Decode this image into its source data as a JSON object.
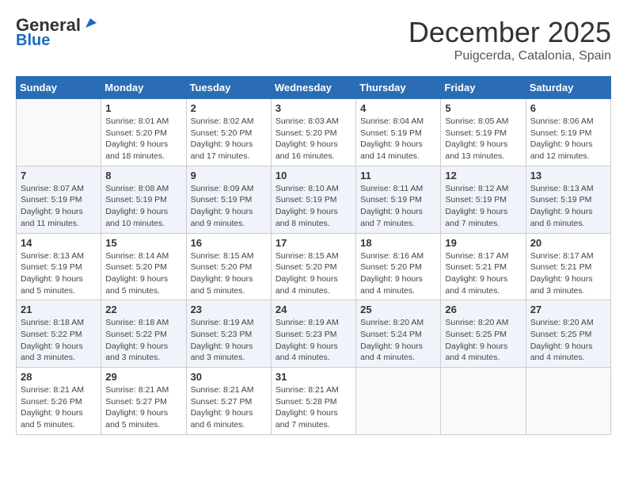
{
  "logo": {
    "line1": "General",
    "line2": "Blue"
  },
  "title": "December 2025",
  "subtitle": "Puigcerda, Catalonia, Spain",
  "weekdays": [
    "Sunday",
    "Monday",
    "Tuesday",
    "Wednesday",
    "Thursday",
    "Friday",
    "Saturday"
  ],
  "weeks": [
    [
      {
        "day": "",
        "info": ""
      },
      {
        "day": "1",
        "info": "Sunrise: 8:01 AM\nSunset: 5:20 PM\nDaylight: 9 hours\nand 18 minutes."
      },
      {
        "day": "2",
        "info": "Sunrise: 8:02 AM\nSunset: 5:20 PM\nDaylight: 9 hours\nand 17 minutes."
      },
      {
        "day": "3",
        "info": "Sunrise: 8:03 AM\nSunset: 5:20 PM\nDaylight: 9 hours\nand 16 minutes."
      },
      {
        "day": "4",
        "info": "Sunrise: 8:04 AM\nSunset: 5:19 PM\nDaylight: 9 hours\nand 14 minutes."
      },
      {
        "day": "5",
        "info": "Sunrise: 8:05 AM\nSunset: 5:19 PM\nDaylight: 9 hours\nand 13 minutes."
      },
      {
        "day": "6",
        "info": "Sunrise: 8:06 AM\nSunset: 5:19 PM\nDaylight: 9 hours\nand 12 minutes."
      }
    ],
    [
      {
        "day": "7",
        "info": "Sunrise: 8:07 AM\nSunset: 5:19 PM\nDaylight: 9 hours\nand 11 minutes."
      },
      {
        "day": "8",
        "info": "Sunrise: 8:08 AM\nSunset: 5:19 PM\nDaylight: 9 hours\nand 10 minutes."
      },
      {
        "day": "9",
        "info": "Sunrise: 8:09 AM\nSunset: 5:19 PM\nDaylight: 9 hours\nand 9 minutes."
      },
      {
        "day": "10",
        "info": "Sunrise: 8:10 AM\nSunset: 5:19 PM\nDaylight: 9 hours\nand 8 minutes."
      },
      {
        "day": "11",
        "info": "Sunrise: 8:11 AM\nSunset: 5:19 PM\nDaylight: 9 hours\nand 7 minutes."
      },
      {
        "day": "12",
        "info": "Sunrise: 8:12 AM\nSunset: 5:19 PM\nDaylight: 9 hours\nand 7 minutes."
      },
      {
        "day": "13",
        "info": "Sunrise: 8:13 AM\nSunset: 5:19 PM\nDaylight: 9 hours\nand 6 minutes."
      }
    ],
    [
      {
        "day": "14",
        "info": "Sunrise: 8:13 AM\nSunset: 5:19 PM\nDaylight: 9 hours\nand 5 minutes."
      },
      {
        "day": "15",
        "info": "Sunrise: 8:14 AM\nSunset: 5:20 PM\nDaylight: 9 hours\nand 5 minutes."
      },
      {
        "day": "16",
        "info": "Sunrise: 8:15 AM\nSunset: 5:20 PM\nDaylight: 9 hours\nand 5 minutes."
      },
      {
        "day": "17",
        "info": "Sunrise: 8:15 AM\nSunset: 5:20 PM\nDaylight: 9 hours\nand 4 minutes."
      },
      {
        "day": "18",
        "info": "Sunrise: 8:16 AM\nSunset: 5:20 PM\nDaylight: 9 hours\nand 4 minutes."
      },
      {
        "day": "19",
        "info": "Sunrise: 8:17 AM\nSunset: 5:21 PM\nDaylight: 9 hours\nand 4 minutes."
      },
      {
        "day": "20",
        "info": "Sunrise: 8:17 AM\nSunset: 5:21 PM\nDaylight: 9 hours\nand 3 minutes."
      }
    ],
    [
      {
        "day": "21",
        "info": "Sunrise: 8:18 AM\nSunset: 5:22 PM\nDaylight: 9 hours\nand 3 minutes."
      },
      {
        "day": "22",
        "info": "Sunrise: 8:18 AM\nSunset: 5:22 PM\nDaylight: 9 hours\nand 3 minutes."
      },
      {
        "day": "23",
        "info": "Sunrise: 8:19 AM\nSunset: 5:23 PM\nDaylight: 9 hours\nand 3 minutes."
      },
      {
        "day": "24",
        "info": "Sunrise: 8:19 AM\nSunset: 5:23 PM\nDaylight: 9 hours\nand 4 minutes."
      },
      {
        "day": "25",
        "info": "Sunrise: 8:20 AM\nSunset: 5:24 PM\nDaylight: 9 hours\nand 4 minutes."
      },
      {
        "day": "26",
        "info": "Sunrise: 8:20 AM\nSunset: 5:25 PM\nDaylight: 9 hours\nand 4 minutes."
      },
      {
        "day": "27",
        "info": "Sunrise: 8:20 AM\nSunset: 5:25 PM\nDaylight: 9 hours\nand 4 minutes."
      }
    ],
    [
      {
        "day": "28",
        "info": "Sunrise: 8:21 AM\nSunset: 5:26 PM\nDaylight: 9 hours\nand 5 minutes."
      },
      {
        "day": "29",
        "info": "Sunrise: 8:21 AM\nSunset: 5:27 PM\nDaylight: 9 hours\nand 5 minutes."
      },
      {
        "day": "30",
        "info": "Sunrise: 8:21 AM\nSunset: 5:27 PM\nDaylight: 9 hours\nand 6 minutes."
      },
      {
        "day": "31",
        "info": "Sunrise: 8:21 AM\nSunset: 5:28 PM\nDaylight: 9 hours\nand 7 minutes."
      },
      {
        "day": "",
        "info": ""
      },
      {
        "day": "",
        "info": ""
      },
      {
        "day": "",
        "info": ""
      }
    ]
  ]
}
